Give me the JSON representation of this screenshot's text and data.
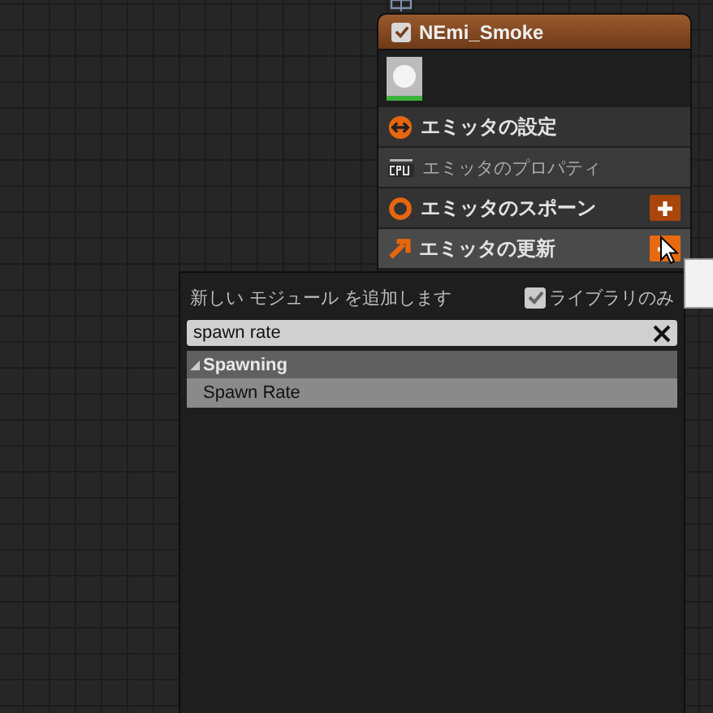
{
  "node": {
    "title": "NEmi_Smoke",
    "enabled": true,
    "sections": [
      {
        "kind": "settings",
        "label": "エミッタの設定",
        "add_button": false,
        "selected": false
      },
      {
        "kind": "cpu",
        "label": "エミッタのプロパティ",
        "add_button": false,
        "selected": false
      },
      {
        "kind": "spawn",
        "label": "エミッタのスポーン",
        "add_button": true,
        "selected": false
      },
      {
        "kind": "update",
        "label": "エミッタの更新",
        "add_button": true,
        "selected": true
      }
    ]
  },
  "popup": {
    "title": "新しい モジュール を追加します",
    "library_only": {
      "label": "ライブラリのみ",
      "checked": true
    },
    "search": {
      "value": "spawn rate"
    },
    "results": [
      {
        "label": "Spawning",
        "expanded": true,
        "children": [
          {
            "label": "Spawn Rate"
          }
        ]
      }
    ]
  }
}
